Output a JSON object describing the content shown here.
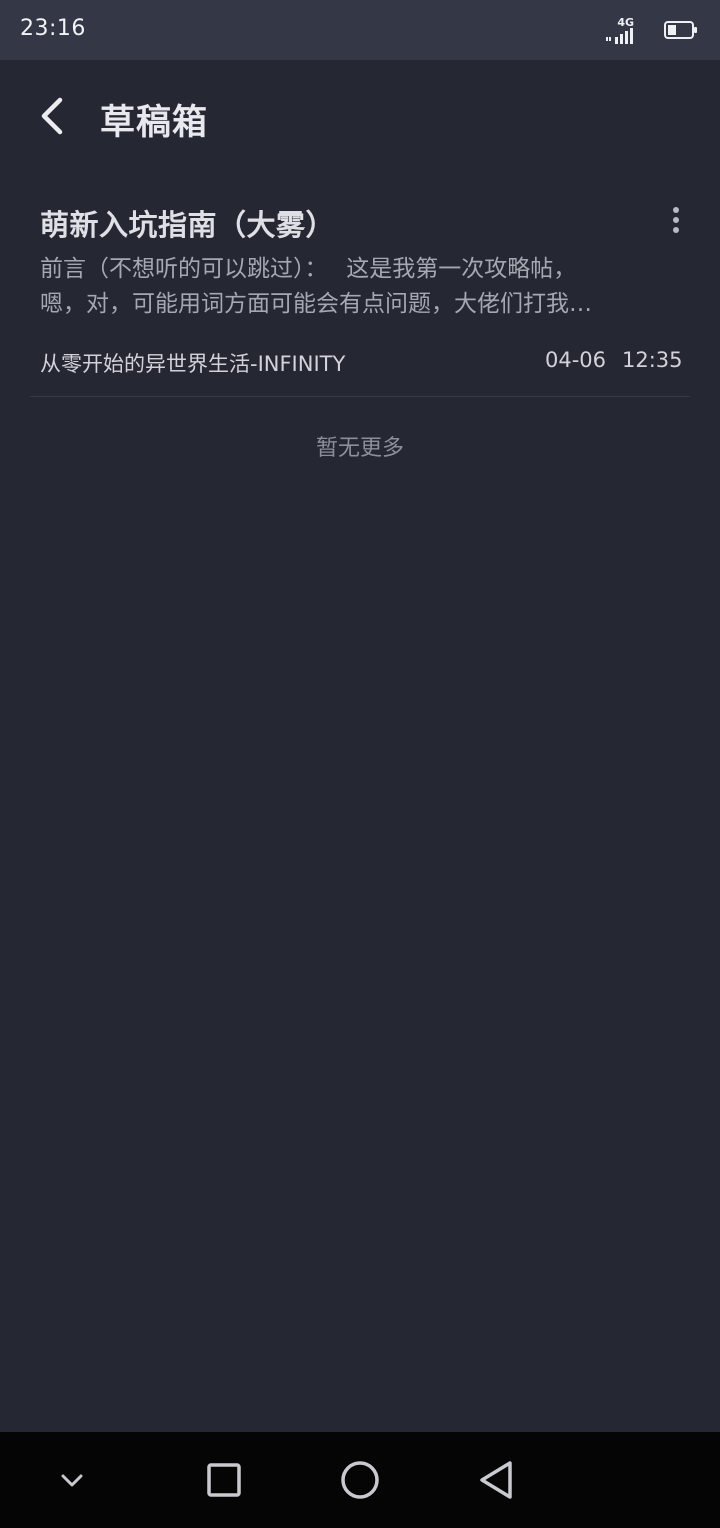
{
  "status_bar": {
    "time": "23:16",
    "network": "4G",
    "icons": [
      "signal-icon",
      "battery-icon"
    ]
  },
  "header": {
    "title": "草稿箱",
    "back_icon": "chevron-left-icon"
  },
  "drafts": [
    {
      "title": "萌新入坑指南（大雾）",
      "excerpt_lines": [
        "前言（不想听的可以跳过）：　 这是我第一次攻略帖，",
        "嗯，对，可能用词方面可能会有点问题，大佬们打我…"
      ],
      "source": "从零开始的异世界生活-INFINITY",
      "date": "04-06",
      "time": "12:35",
      "menu_icon": "more-vertical-icon"
    }
  ],
  "list_footer": "暂无更多",
  "nav_bar": {
    "icons": [
      "chevron-down-icon",
      "square-icon",
      "circle-icon",
      "triangle-back-icon"
    ]
  },
  "colors": {
    "background": "#252733",
    "status_bar": "#343846",
    "nav_bar": "#050506",
    "text_primary": "#dfe0e6",
    "text_secondary": "#a5a7b1"
  }
}
